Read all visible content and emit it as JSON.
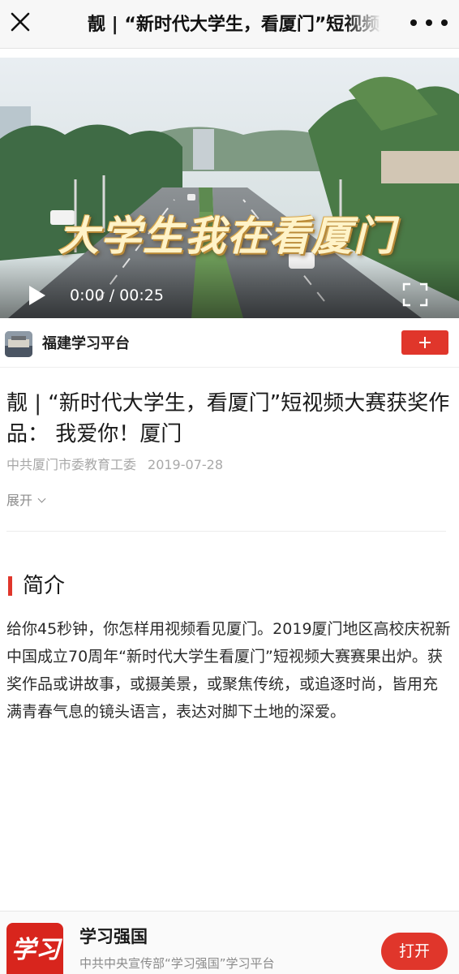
{
  "nav": {
    "title": "靓 | “新时代大学生，看厦门”短视频大赛获奖作品： 我爱你！厦门",
    "close_icon": "close-icon",
    "more_icon": "more-icon"
  },
  "video": {
    "overlay_title": "大学生我在看厦门",
    "time": "0:00 / 00:25",
    "play_icon": "play-icon",
    "fullscreen_icon": "fullscreen-icon"
  },
  "author": {
    "name": "福建学习平台",
    "follow_icon": "plus-icon"
  },
  "article": {
    "title": "靓 | “新时代大学生，看厦门”短视频大赛获奖作品： 我爱你！厦门",
    "source": "中共厦门市委教育工委",
    "date": "2019-07-28",
    "expand_label": "展开"
  },
  "intro": {
    "heading": "简介",
    "body": "给你45秒钟，你怎样用视频看见厦门。2019厦门地区高校庆祝新中国成立70周年“新时代大学生看厦门”短视频大赛赛果出炉。获奖作品或讲故事，或摄美景，或聚焦传统，或追逐时尚，皆用充满青春气息的镜头语言，表达对脚下土地的深爱。"
  },
  "banner": {
    "app_name": "学习强国",
    "app_desc": "中共中央宣传部“学习强国”学习平台",
    "open_label": "打开",
    "logo_text": "学习",
    "accent_color": "#e0362b"
  }
}
